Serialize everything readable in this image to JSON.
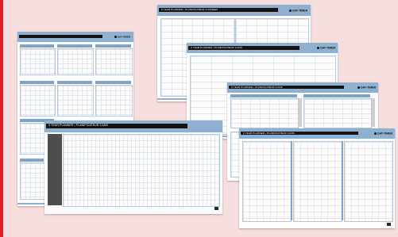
{
  "planner_title": "3 YEAR PLANNER • PLANIFICATEUR 3 ANS",
  "planner_title_short": "3 YEAR PLANNER • PLANIFICATEUR 3 ANNEES",
  "brand": "DAY-TIMER",
  "colors": {
    "background": "#f6dede",
    "accent_blue": "#8fb0cf",
    "header_bar": "#141414",
    "left_edge": "#e0202c"
  }
}
